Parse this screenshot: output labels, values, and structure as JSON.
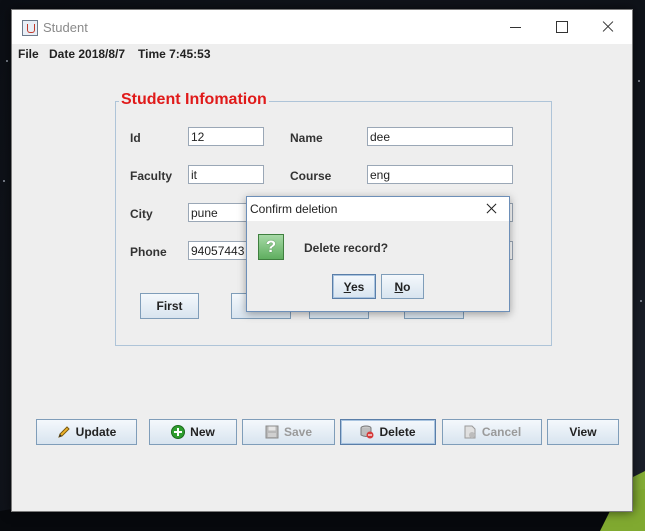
{
  "window": {
    "title": "Student"
  },
  "menubar": {
    "file": "File",
    "date": "Date 2018/8/7",
    "time": "Time 7:45:53"
  },
  "panel": {
    "title": "Student Infomation"
  },
  "fields": {
    "id": {
      "label": "Id",
      "value": "12"
    },
    "name": {
      "label": "Name",
      "value": "dee"
    },
    "faculty": {
      "label": "Faculty",
      "value": "it"
    },
    "course": {
      "label": "Course",
      "value": "eng"
    },
    "city": {
      "label": "City",
      "value": "pune"
    },
    "phone": {
      "label": "Phone",
      "value": "94057443"
    }
  },
  "nav": {
    "first": "First"
  },
  "toolbar": {
    "update": "Update",
    "new": "New",
    "save": "Save",
    "delete": "Delete",
    "cancel": "Cancel",
    "view": "View"
  },
  "dialog": {
    "title": "Confirm deletion",
    "message": "Delete record?",
    "yes_mnemonic": "Y",
    "yes_rest": "es",
    "no_mnemonic": "N",
    "no_rest": "o"
  },
  "icons": {
    "update": "pencil-icon",
    "new": "plus-circle-icon",
    "save": "floppy-disk-icon",
    "delete": "database-delete-icon",
    "cancel": "document-cancel-icon",
    "dialog": "question-icon"
  },
  "colors": {
    "panel_title": "#e01a1a",
    "accent_border": "#7f9db9"
  }
}
